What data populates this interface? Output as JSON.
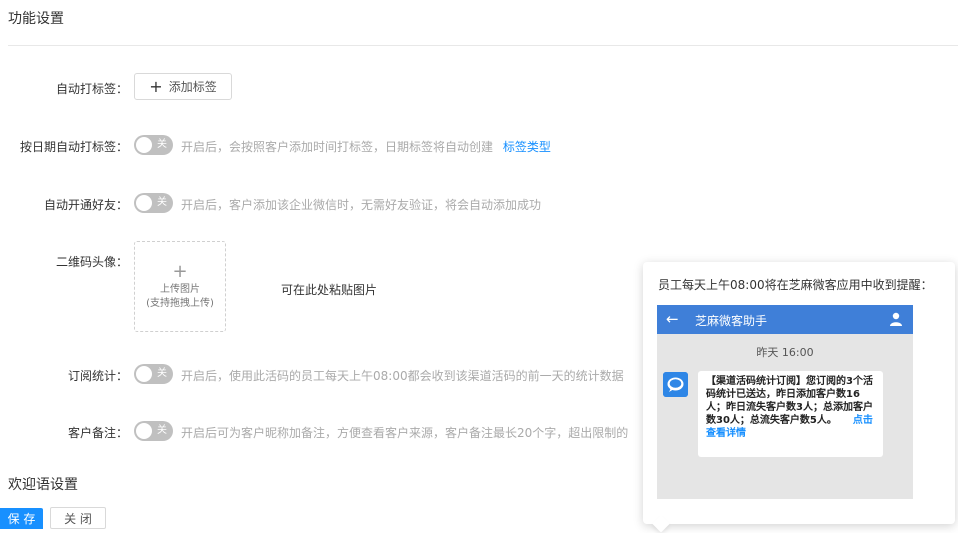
{
  "sections": {
    "feature_settings": "功能设置",
    "welcome_settings": "欢迎语设置"
  },
  "auto_tag": {
    "label": "自动打标签：",
    "button": "添加标签"
  },
  "date_tag": {
    "label": "按日期自动打标签：",
    "toggle": "关",
    "hint": "开启后，会按照客户添加时间打标签，日期标签将自动创建",
    "link": "标签类型"
  },
  "auto_friend": {
    "label": "自动开通好友：",
    "toggle": "关",
    "hint": "开启后，客户添加该企业微信时，无需好友验证，将会自动添加成功"
  },
  "qr_avatar": {
    "label": "二维码头像：",
    "upload_line1": "上传图片",
    "upload_line2": "(支持拖拽上传)",
    "paste_hint": "可在此处粘贴图片"
  },
  "subscription": {
    "label": "订阅统计：",
    "toggle": "关",
    "hint": "开启后，使用此活码的员工每天上午08:00都会收到该渠道活码的前一天的统计数据"
  },
  "customer_note": {
    "label": "客户备注：",
    "toggle": "关",
    "hint": "开启后可为客户昵称加备注，方便查看客户来源，客户备注最长20个字，超出限制的"
  },
  "footer": {
    "save": "保 存",
    "close": "关 闭"
  },
  "popover": {
    "title": "员工每天上午08:00将在芝麻微客应用中收到提醒：",
    "app_name": "芝麻微客助手",
    "time": "昨天  16:00",
    "message": "【渠道活码统计订阅】您订阅的3个活码统计已送达，昨日添加客户数16人；昨日流失客户数3人；总添加客户数30人；总流失客户数5人。",
    "detail_link": "点击查看详情"
  },
  "colors": {
    "primary": "#1890ff",
    "toggle_off": "#c0c0c0",
    "app_bar": "#3f7fd8"
  }
}
